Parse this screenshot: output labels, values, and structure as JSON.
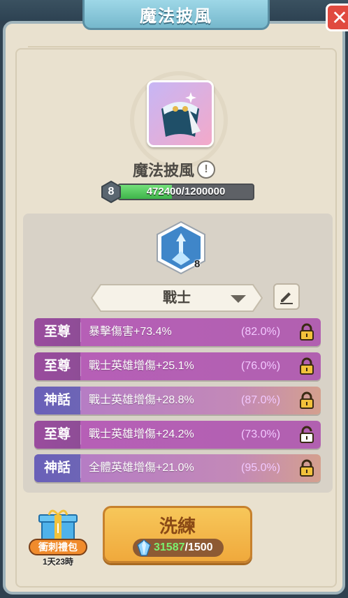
{
  "window": {
    "title": "魔法披風"
  },
  "item": {
    "name": "魔法披風",
    "level": "8",
    "xp_text": "472400/1200000",
    "xp_fraction": 0.3937
  },
  "class_emblem": {
    "level": "8"
  },
  "class_select": {
    "selected": "戰士"
  },
  "attributes": [
    {
      "tier": "至尊",
      "tier_kind": "supreme",
      "stat": "暴擊傷害+73.4%",
      "percent": "(82.0%)",
      "locked": true
    },
    {
      "tier": "至尊",
      "tier_kind": "supreme",
      "stat": "戰士英雄增傷+25.1%",
      "percent": "(76.0%)",
      "locked": true
    },
    {
      "tier": "神話",
      "tier_kind": "myth",
      "stat": "戰士英雄增傷+28.8%",
      "percent": "(87.0%)",
      "locked": true
    },
    {
      "tier": "至尊",
      "tier_kind": "supreme",
      "stat": "戰士英雄增傷+24.2%",
      "percent": "(73.0%)",
      "locked": false
    },
    {
      "tier": "神話",
      "tier_kind": "myth",
      "stat": "全體英雄增傷+21.0%",
      "percent": "(95.0%)",
      "locked": true
    }
  ],
  "gift": {
    "label": "衝刺禮包",
    "timer": "1天23時",
    "icon": "gift-box-icon"
  },
  "reroll": {
    "label": "洗練",
    "owned": "31587",
    "cost": "/1500",
    "icon": "crystal-gem-icon"
  },
  "colors": {
    "supreme": "#b75fb8",
    "myth": "#6a60b8",
    "button": "#f0a93c",
    "xp": "#3eb44a"
  }
}
